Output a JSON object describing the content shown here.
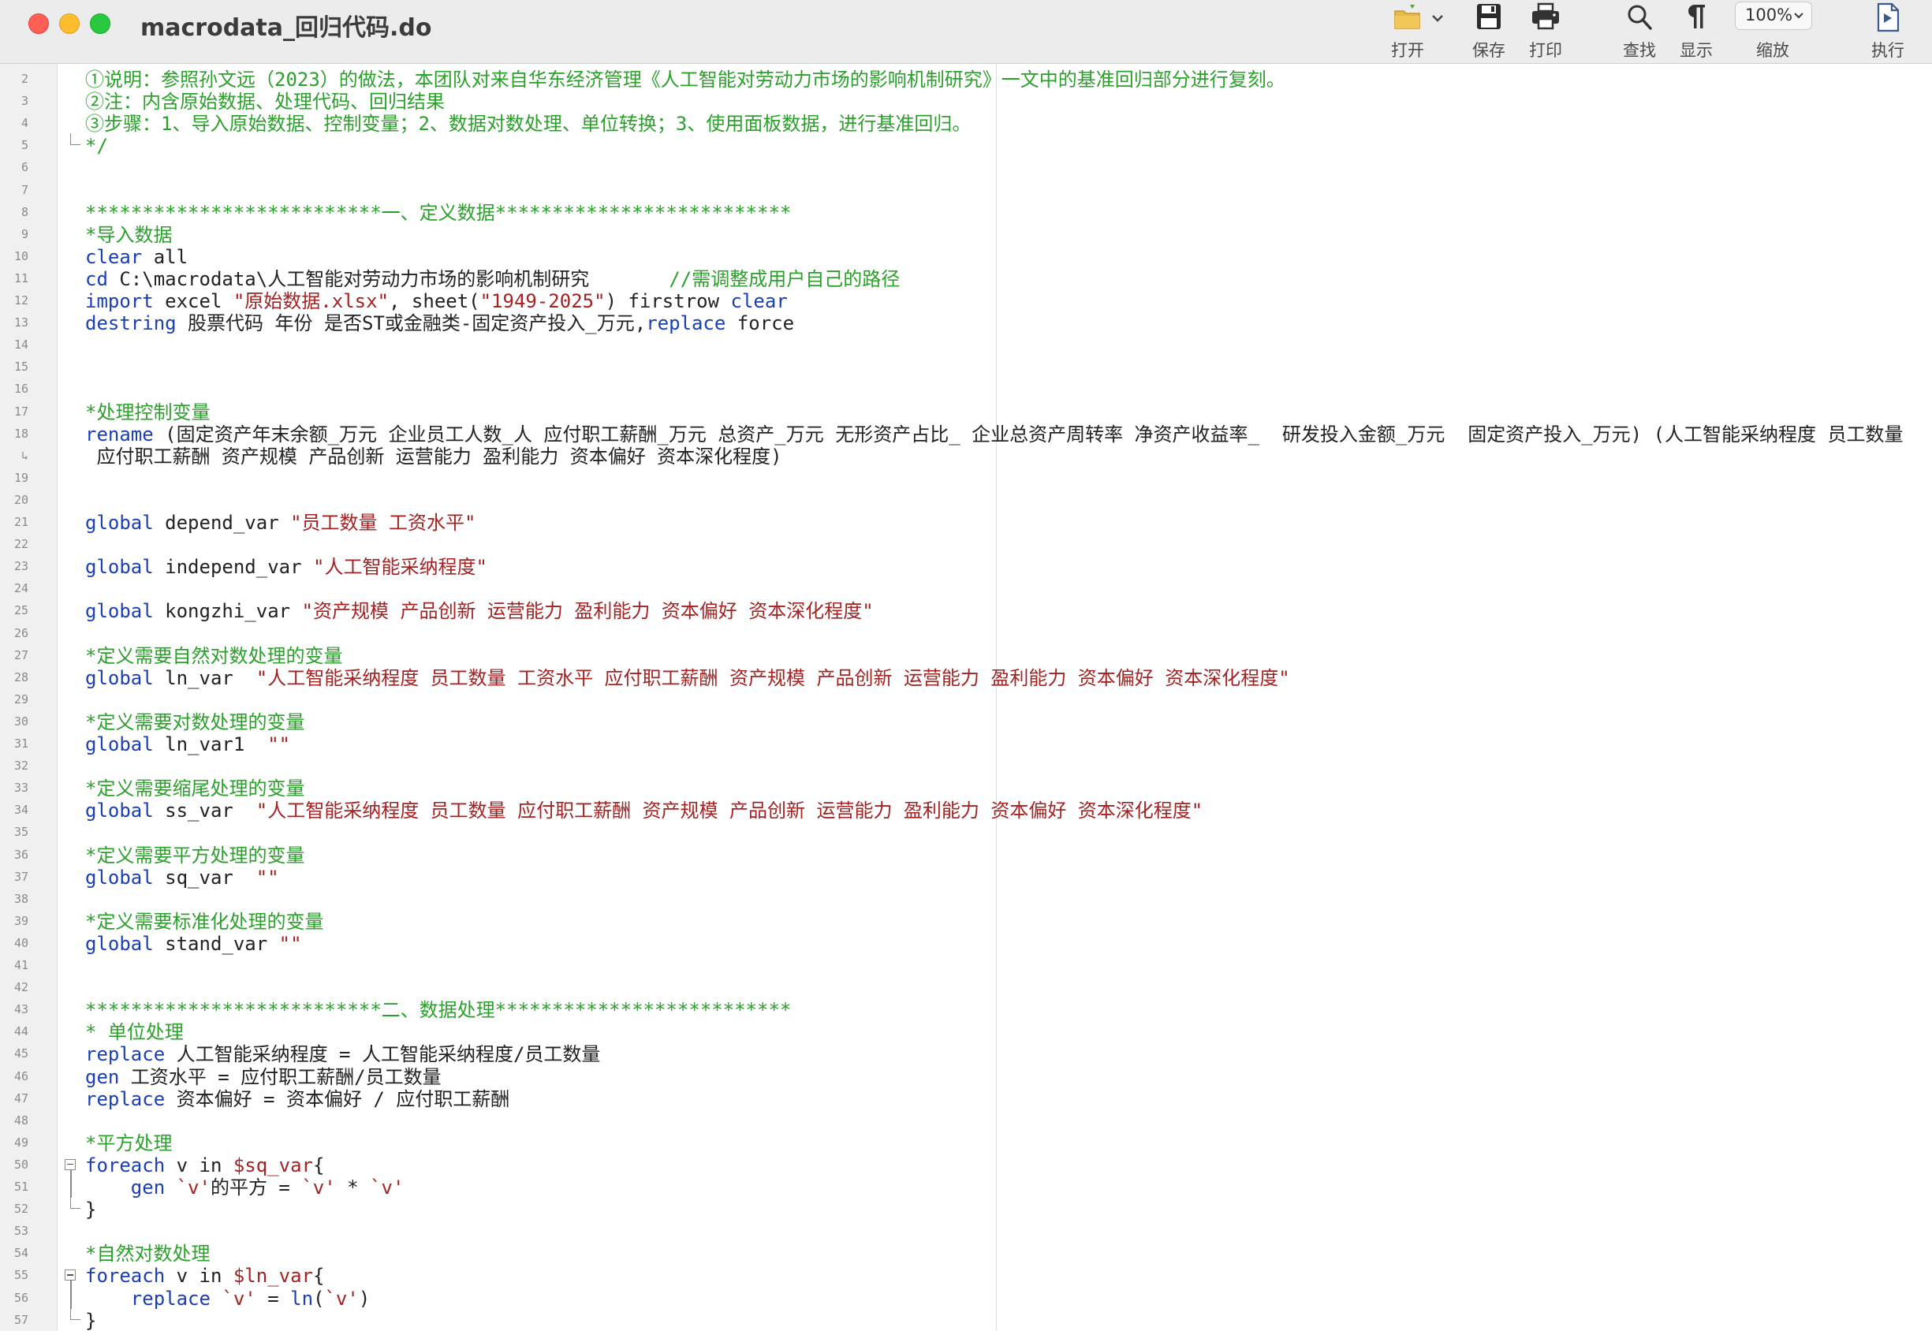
{
  "window": {
    "title": "macrodata_回归代码.do"
  },
  "toolbar": {
    "open_label": "打开",
    "save_label": "保存",
    "print_label": "打印",
    "find_label": "查找",
    "show_label": "显示",
    "zoom_label": "缩放",
    "zoom_value": "100%",
    "run_label": "执行"
  },
  "icons": {
    "open": "folder-icon",
    "save": "floppy-disk-icon",
    "print": "printer-icon",
    "find": "magnifier-icon",
    "show": "pilcrow-icon",
    "run": "run-document-icon"
  },
  "colors": {
    "comment": "#2ba02b",
    "keyword": "#1a3fb4",
    "string": "#a32323",
    "text": "#111111"
  },
  "lines": [
    {
      "n": "2",
      "t": [
        [
          "c",
          "①说明：参照孙文远（2023）的做法，本团队对来自华东经济管理《人工智能对劳动力市场的影响机制研究》一文中的基准回归部分进行复刻。"
        ]
      ]
    },
    {
      "n": "3",
      "t": [
        [
          "c",
          "②注：内含原始数据、处理代码、回归结果"
        ]
      ]
    },
    {
      "n": "4",
      "t": [
        [
          "c",
          "③步骤：1、导入原始数据、控制变量；2、数据对数处理、单位转换；3、使用面板数据，进行基准回归。"
        ]
      ]
    },
    {
      "n": "5",
      "fold": "end",
      "t": [
        [
          "c",
          "*/"
        ]
      ]
    },
    {
      "n": "6",
      "t": []
    },
    {
      "n": "7",
      "t": []
    },
    {
      "n": "8",
      "t": [
        [
          "c",
          "**************************一、定义数据**************************"
        ]
      ]
    },
    {
      "n": "9",
      "t": [
        [
          "c",
          "*导入数据"
        ]
      ]
    },
    {
      "n": "10",
      "t": [
        [
          "k",
          "clear"
        ],
        [
          "m",
          " all"
        ]
      ]
    },
    {
      "n": "11",
      "t": [
        [
          "k",
          "cd"
        ],
        [
          "m",
          " C:\\macrodata\\人工智能对劳动力市场的影响机制研究       "
        ],
        [
          "c",
          "//需调整成用户自己的路径"
        ]
      ]
    },
    {
      "n": "12",
      "t": [
        [
          "k",
          "import"
        ],
        [
          "m",
          " excel "
        ],
        [
          "s",
          "\"原始数据.xlsx\""
        ],
        [
          "m",
          ", sheet("
        ],
        [
          "s",
          "\"1949-2025\""
        ],
        [
          "m",
          ") firstrow "
        ],
        [
          "k",
          "clear"
        ]
      ]
    },
    {
      "n": "13",
      "t": [
        [
          "k",
          "destring"
        ],
        [
          "m",
          " 股票代码 年份 是否ST或金融类-固定资产投入_万元,"
        ],
        [
          "k",
          "replace"
        ],
        [
          "m",
          " force"
        ]
      ]
    },
    {
      "n": "14",
      "t": []
    },
    {
      "n": "15",
      "t": []
    },
    {
      "n": "16",
      "t": []
    },
    {
      "n": "17",
      "t": [
        [
          "c",
          "*处理控制变量"
        ]
      ]
    },
    {
      "n": "18",
      "t": [
        [
          "k",
          "rename"
        ],
        [
          "m",
          " (固定资产年末余额_万元 企业员工人数_人 应付职工薪酬_万元 总资产_万元 无形资产占比_ 企业总资产周转率 净资产收益率_  研发投入金额_万元  固定资产投入_万元) (人工智能采纳程度 员工数量"
        ]
      ]
    },
    {
      "n": "↳",
      "t": [
        [
          "m",
          " 应付职工薪酬 资产规模 产品创新 运营能力 盈利能力 资本偏好 资本深化程度)"
        ]
      ]
    },
    {
      "n": "19",
      "t": []
    },
    {
      "n": "20",
      "t": []
    },
    {
      "n": "21",
      "t": [
        [
          "k",
          "global"
        ],
        [
          "m",
          " depend_var "
        ],
        [
          "s",
          "\"员工数量 工资水平\""
        ]
      ]
    },
    {
      "n": "22",
      "t": []
    },
    {
      "n": "23",
      "t": [
        [
          "k",
          "global"
        ],
        [
          "m",
          " independ_var "
        ],
        [
          "s",
          "\"人工智能采纳程度\""
        ]
      ]
    },
    {
      "n": "24",
      "t": []
    },
    {
      "n": "25",
      "t": [
        [
          "k",
          "global"
        ],
        [
          "m",
          " kongzhi_var "
        ],
        [
          "s",
          "\"资产规模 产品创新 运营能力 盈利能力 资本偏好 资本深化程度\""
        ]
      ]
    },
    {
      "n": "26",
      "t": []
    },
    {
      "n": "27",
      "t": [
        [
          "c",
          "*定义需要自然对数处理的变量"
        ]
      ]
    },
    {
      "n": "28",
      "t": [
        [
          "k",
          "global"
        ],
        [
          "m",
          " ln_var  "
        ],
        [
          "s",
          "\"人工智能采纳程度 员工数量 工资水平 应付职工薪酬 资产规模 产品创新 运营能力 盈利能力 资本偏好 资本深化程度\""
        ]
      ]
    },
    {
      "n": "29",
      "t": []
    },
    {
      "n": "30",
      "t": [
        [
          "c",
          "*定义需要对数处理的变量"
        ]
      ]
    },
    {
      "n": "31",
      "t": [
        [
          "k",
          "global"
        ],
        [
          "m",
          " ln_var1  "
        ],
        [
          "s",
          "\"\""
        ]
      ]
    },
    {
      "n": "32",
      "t": []
    },
    {
      "n": "33",
      "t": [
        [
          "c",
          "*定义需要缩尾处理的变量"
        ]
      ]
    },
    {
      "n": "34",
      "t": [
        [
          "k",
          "global"
        ],
        [
          "m",
          " ss_var  "
        ],
        [
          "s",
          "\"人工智能采纳程度 员工数量 应付职工薪酬 资产规模 产品创新 运营能力 盈利能力 资本偏好 资本深化程度\""
        ]
      ]
    },
    {
      "n": "35",
      "t": []
    },
    {
      "n": "36",
      "t": [
        [
          "c",
          "*定义需要平方处理的变量"
        ]
      ]
    },
    {
      "n": "37",
      "t": [
        [
          "k",
          "global"
        ],
        [
          "m",
          " sq_var  "
        ],
        [
          "s",
          "\"\""
        ]
      ]
    },
    {
      "n": "38",
      "t": []
    },
    {
      "n": "39",
      "t": [
        [
          "c",
          "*定义需要标准化处理的变量"
        ]
      ]
    },
    {
      "n": "40",
      "t": [
        [
          "k",
          "global"
        ],
        [
          "m",
          " stand_var "
        ],
        [
          "s",
          "\"\""
        ]
      ]
    },
    {
      "n": "41",
      "t": []
    },
    {
      "n": "42",
      "t": []
    },
    {
      "n": "43",
      "t": [
        [
          "c",
          "**************************二、数据处理**************************"
        ]
      ]
    },
    {
      "n": "44",
      "t": [
        [
          "c",
          "* 单位处理"
        ]
      ]
    },
    {
      "n": "45",
      "t": [
        [
          "k",
          "replace"
        ],
        [
          "m",
          " 人工智能采纳程度 = 人工智能采纳程度/员工数量"
        ]
      ]
    },
    {
      "n": "46",
      "t": [
        [
          "k",
          "gen"
        ],
        [
          "m",
          " 工资水平 = 应付职工薪酬/员工数量"
        ]
      ]
    },
    {
      "n": "47",
      "t": [
        [
          "k",
          "replace"
        ],
        [
          "m",
          " 资本偏好 = 资本偏好 / 应付职工薪酬"
        ]
      ]
    },
    {
      "n": "48",
      "t": []
    },
    {
      "n": "49",
      "t": [
        [
          "c",
          "*平方处理"
        ]
      ]
    },
    {
      "n": "50",
      "fold": "start",
      "t": [
        [
          "k",
          "foreach"
        ],
        [
          "m",
          " v in "
        ],
        [
          "s",
          "$sq_var"
        ],
        [
          "m",
          "{"
        ]
      ]
    },
    {
      "n": "51",
      "fold": "mid",
      "t": [
        [
          "m",
          "    "
        ],
        [
          "k",
          "gen"
        ],
        [
          "m",
          " "
        ],
        [
          "s",
          "`v'"
        ],
        [
          "m",
          "的平方 = "
        ],
        [
          "s",
          "`v'"
        ],
        [
          "m",
          " * "
        ],
        [
          "s",
          "`v'"
        ]
      ]
    },
    {
      "n": "52",
      "fold": "end",
      "t": [
        [
          "m",
          "}"
        ]
      ]
    },
    {
      "n": "53",
      "t": []
    },
    {
      "n": "54",
      "t": [
        [
          "c",
          "*自然对数处理"
        ]
      ]
    },
    {
      "n": "55",
      "fold": "start",
      "t": [
        [
          "k",
          "foreach"
        ],
        [
          "m",
          " v in "
        ],
        [
          "s",
          "$ln_var"
        ],
        [
          "m",
          "{"
        ]
      ]
    },
    {
      "n": "56",
      "fold": "mid",
      "t": [
        [
          "m",
          "    "
        ],
        [
          "k",
          "replace"
        ],
        [
          "m",
          " "
        ],
        [
          "s",
          "`v'"
        ],
        [
          "m",
          " = "
        ],
        [
          "k",
          "ln"
        ],
        [
          "m",
          "("
        ],
        [
          "s",
          "`v'"
        ],
        [
          "m",
          ")"
        ]
      ]
    },
    {
      "n": "57",
      "fold": "end",
      "t": [
        [
          "m",
          "}"
        ]
      ]
    }
  ]
}
